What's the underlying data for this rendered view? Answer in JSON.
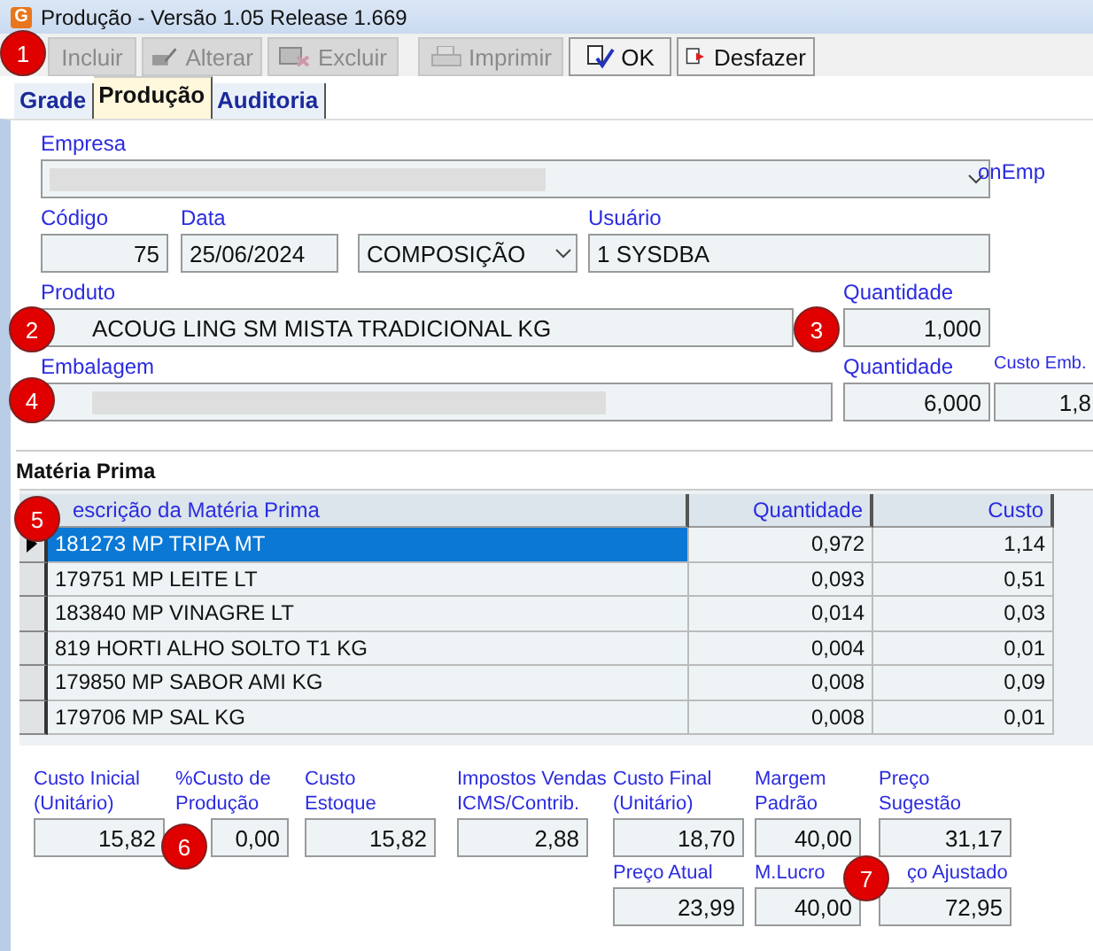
{
  "window": {
    "title": "Produção - Versão 1.05 Release 1.669",
    "icon_letter": "G"
  },
  "toolbar": [
    {
      "label": "Incluir",
      "disabled": true
    },
    {
      "label": "Alterar",
      "disabled": true
    },
    {
      "label": "Excluir",
      "disabled": true
    },
    {
      "label": "Imprimir",
      "disabled": true
    },
    {
      "label": "OK",
      "disabled": false
    },
    {
      "label": "Desfazer",
      "disabled": false
    }
  ],
  "tabs": [
    {
      "label": "Grade",
      "selected": false
    },
    {
      "label": "Produção",
      "selected": true
    },
    {
      "label": "Auditoria",
      "selected": false
    }
  ],
  "empresa": {
    "label": "Empresa",
    "side_label": "onEmp"
  },
  "codigo": {
    "label": "Código",
    "value": "75"
  },
  "data": {
    "label": "Data",
    "value": "25/06/2024"
  },
  "tipo": {
    "value": "COMPOSIÇÃO"
  },
  "usuario": {
    "label": "Usuário",
    "value": "1 SYSDBA"
  },
  "produto": {
    "label": "Produto",
    "value": "ACOUG LING SM MISTA TRADICIONAL  KG"
  },
  "produto_quantidade": {
    "label": "Quantidade",
    "value": "1,000"
  },
  "embalagem": {
    "label": "Embalagem"
  },
  "embalagem_quantidade": {
    "label": "Quantidade",
    "value": "6,000"
  },
  "custo_emb": {
    "label": "Custo Emb.",
    "value": "1,8"
  },
  "materia_prima": {
    "title": "Matéria Prima",
    "columns": [
      "escrição da Matéria Prima",
      "Quantidade",
      "Custo"
    ],
    "rows": [
      {
        "cells": [
          "181273 MP TRIPA MT",
          "0,972",
          "1,14"
        ],
        "selected": true
      },
      {
        "cells": [
          "179751 MP LEITE LT",
          "0,093",
          "0,51"
        ],
        "selected": false
      },
      {
        "cells": [
          "183840 MP VINAGRE LT",
          "0,014",
          "0,03"
        ],
        "selected": false
      },
      {
        "cells": [
          "819 HORTI ALHO SOLTO T1 KG",
          "0,004",
          "0,01"
        ],
        "selected": false
      },
      {
        "cells": [
          "179850 MP SABOR AMI KG",
          "0,008",
          "0,09"
        ],
        "selected": false
      },
      {
        "cells": [
          "179706 MP SAL KG",
          "0,008",
          "0,01"
        ],
        "selected": false
      }
    ]
  },
  "totals": [
    {
      "label": "Custo Inicial\n(Unitário)",
      "value": "15,82"
    },
    {
      "label": "%Custo de\nProdução",
      "value": "0,00"
    },
    {
      "label": "Custo\nEstoque",
      "value": "15,82"
    },
    {
      "label": "Impostos Vendas\nICMS/Contrib.",
      "value": "2,88"
    },
    {
      "label": "Custo Final\n(Unitário)",
      "value": "18,70"
    },
    {
      "label": "Margem\nPadrão",
      "value": "40,00"
    },
    {
      "label": "Preço\nSugestão",
      "value": "31,17"
    }
  ],
  "totals_second_row": [
    {
      "label": "Preço Atual",
      "value": "23,99"
    },
    {
      "label": "M.Lucro",
      "value": "40,00"
    },
    {
      "label": "ço Ajustado",
      "value": "72,95"
    }
  ],
  "markers": [
    "1",
    "2",
    "3",
    "4",
    "5",
    "6",
    "7"
  ]
}
